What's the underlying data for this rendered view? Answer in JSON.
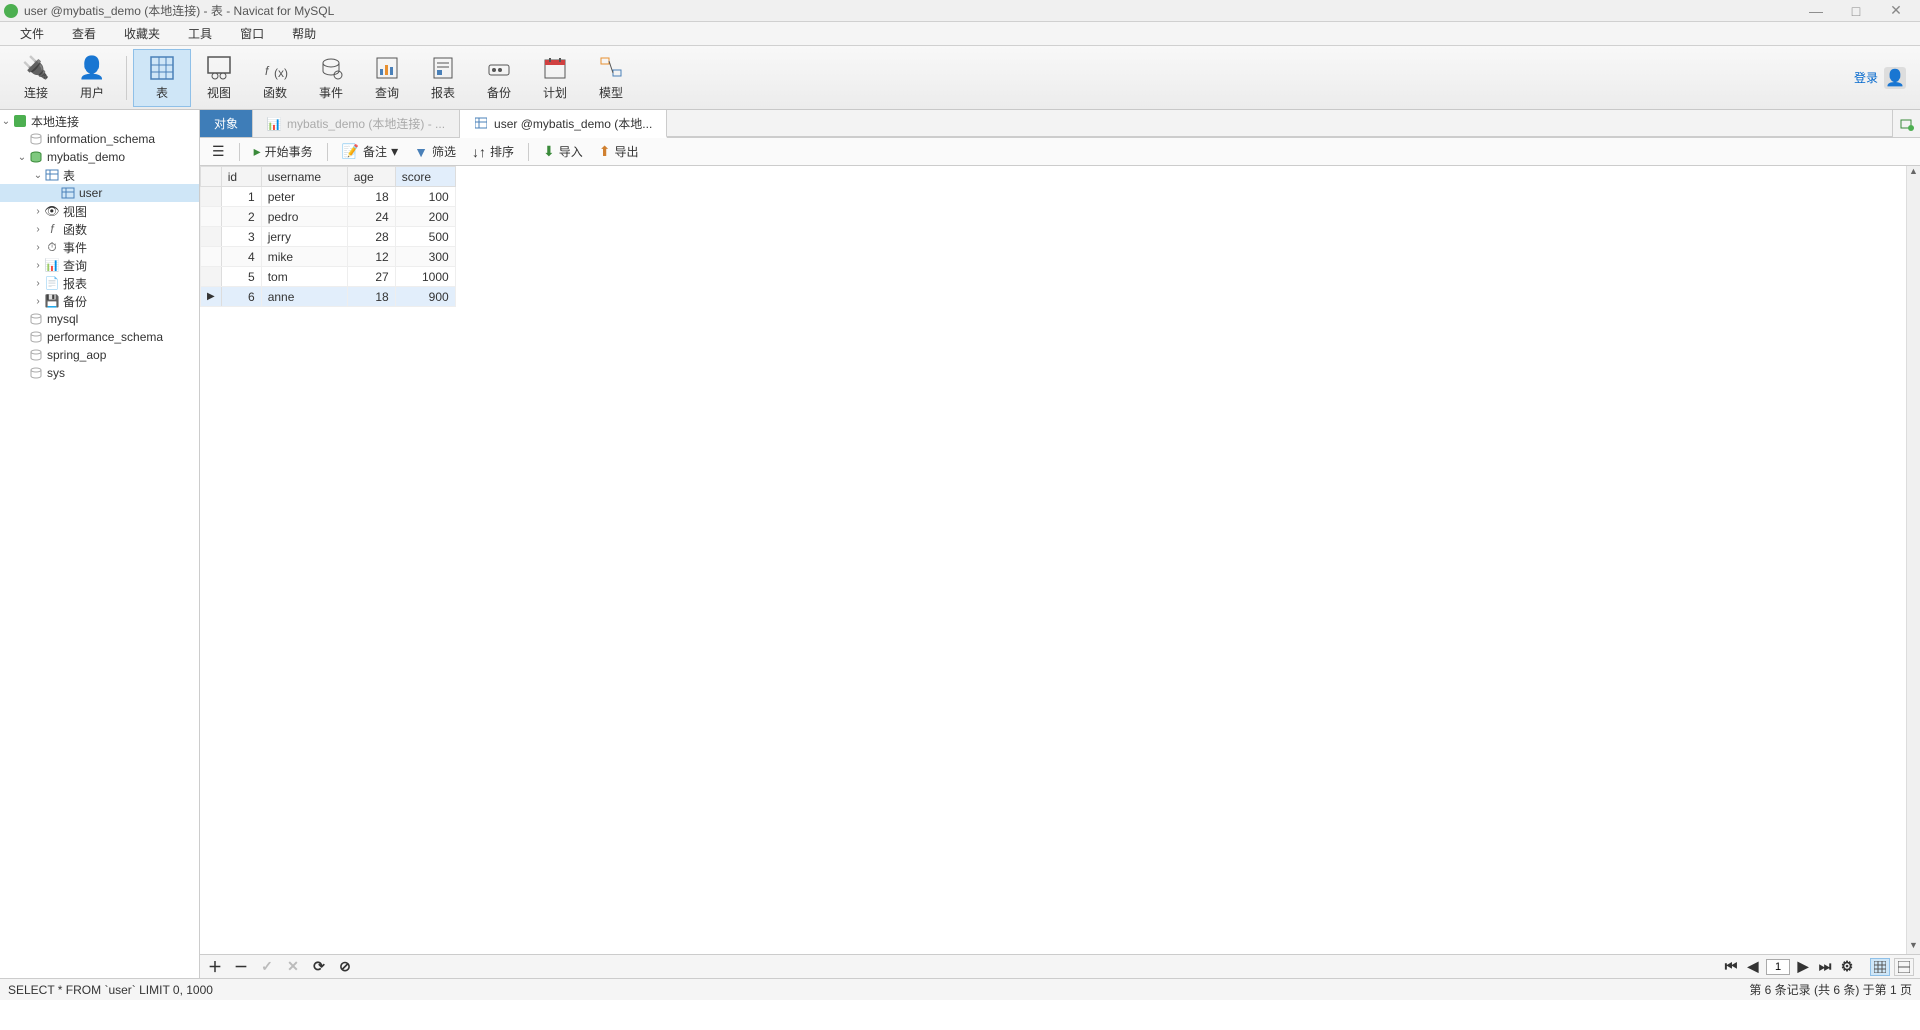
{
  "titlebar": {
    "title": "user @mybatis_demo (本地连接) - 表 - Navicat for MySQL"
  },
  "menu": {
    "file": "文件",
    "view": "查看",
    "favorites": "收藏夹",
    "tools": "工具",
    "window": "窗口",
    "help": "帮助"
  },
  "ribbon": {
    "connection": "连接",
    "user": "用户",
    "table": "表",
    "view": "视图",
    "function": "函数",
    "event": "事件",
    "query": "查询",
    "report": "报表",
    "backup": "备份",
    "schedule": "计划",
    "model": "模型",
    "login": "登录"
  },
  "tree": {
    "connection": "本地连接",
    "dbs": {
      "information_schema": "information_schema",
      "mybatis_demo": "mybatis_demo",
      "mysql": "mysql",
      "performance_schema": "performance_schema",
      "spring_aop": "spring_aop",
      "sys": "sys"
    },
    "folders": {
      "table": "表",
      "view": "视图",
      "function": "函数",
      "event": "事件",
      "query": "查询",
      "report": "报表",
      "backup": "备份"
    },
    "table_name": "user"
  },
  "tabs": {
    "objects": "对象",
    "tab2": "mybatis_demo (本地连接) - ...",
    "tab3": "user @mybatis_demo (本地..."
  },
  "intoolbar": {
    "begin_tx": "开始事务",
    "memo": "备注",
    "filter": "筛选",
    "sort": "排序",
    "import": "导入",
    "export": "导出"
  },
  "grid": {
    "columns": [
      "id",
      "username",
      "age",
      "score"
    ],
    "rows": [
      {
        "id": 1,
        "username": "peter",
        "age": 18,
        "score": 100
      },
      {
        "id": 2,
        "username": "pedro",
        "age": 24,
        "score": 200
      },
      {
        "id": 3,
        "username": "jerry",
        "age": 28,
        "score": 500
      },
      {
        "id": 4,
        "username": "mike",
        "age": 12,
        "score": 300
      },
      {
        "id": 5,
        "username": "tom",
        "age": 27,
        "score": 1000
      },
      {
        "id": 6,
        "username": "anne",
        "age": 18,
        "score": 900
      }
    ],
    "selected_row": 5
  },
  "bottomnav": {
    "page": "1"
  },
  "statusbar": {
    "sql": "SELECT * FROM `user` LIMIT 0, 1000",
    "record": "第 6 条记录 (共 6 条) 于第 1 页"
  }
}
